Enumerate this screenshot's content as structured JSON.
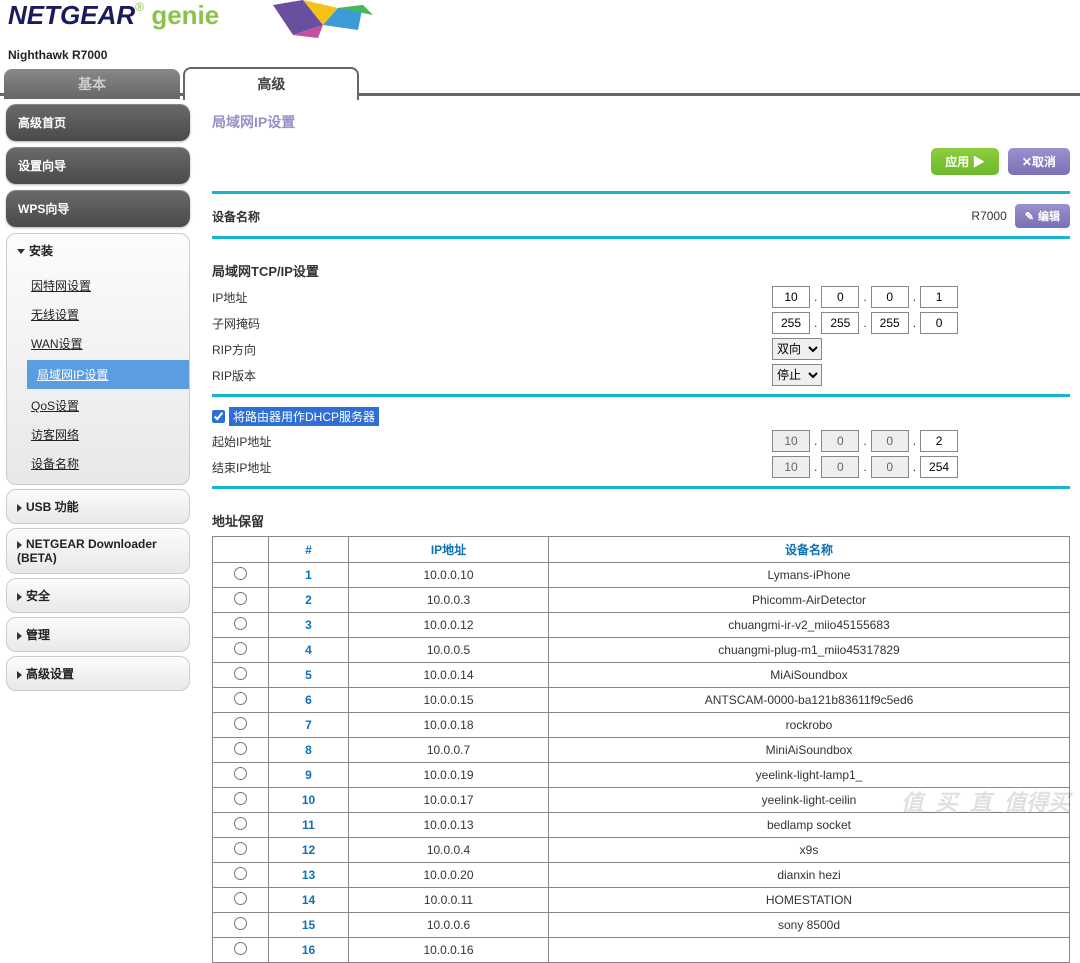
{
  "header": {
    "brand": "NETGEAR",
    "sub_brand": "genie",
    "model": "Nighthawk R7000"
  },
  "tabs": {
    "basic": "基本",
    "advanced": "高级"
  },
  "sidebar": {
    "adv_home": "高级首页",
    "setup_wizard": "设置向导",
    "wps_wizard": "WPS向导",
    "install": {
      "title": "安装",
      "items": [
        "因特网设置",
        "无线设置",
        "WAN设置",
        "局域网IP设置",
        "QoS设置",
        "访客网络",
        "设备名称"
      ]
    },
    "usb": "USB 功能",
    "downloader": "NETGEAR Downloader (BETA)",
    "security": "安全",
    "manage": "管理",
    "adv_setup": "高级设置"
  },
  "page": {
    "title": "局域网IP设置",
    "apply": "应用",
    "cancel": "取消",
    "device_name_label": "设备名称",
    "device_name": "R7000",
    "edit": "编辑",
    "tcpip_head": "局域网TCP/IP设置",
    "ip_label": "IP地址",
    "ip": [
      "10",
      "0",
      "0",
      "1"
    ],
    "mask_label": "子网掩码",
    "mask": [
      "255",
      "255",
      "255",
      "0"
    ],
    "rip_dir_label": "RIP方向",
    "rip_dir": "双向",
    "rip_ver_label": "RIP版本",
    "rip_ver": "停止",
    "dhcp_label": "将路由器用作DHCP服务器",
    "start_ip_label": "起始IP地址",
    "start_ip": [
      "10",
      "0",
      "0",
      "2"
    ],
    "end_ip_label": "结束IP地址",
    "end_ip": [
      "10",
      "0",
      "0",
      "254"
    ],
    "reserve_head": "地址保留",
    "table_headers": [
      "#",
      "IP地址",
      "设备名称"
    ],
    "rows": [
      {
        "n": "1",
        "ip": "10.0.0.10",
        "name": "Lymans-iPhone"
      },
      {
        "n": "2",
        "ip": "10.0.0.3",
        "name": "Phicomm-AirDetector"
      },
      {
        "n": "3",
        "ip": "10.0.0.12",
        "name": "chuangmi-ir-v2_miio45155683"
      },
      {
        "n": "4",
        "ip": "10.0.0.5",
        "name": "chuangmi-plug-m1_miio45317829"
      },
      {
        "n": "5",
        "ip": "10.0.0.14",
        "name": "MiAiSoundbox"
      },
      {
        "n": "6",
        "ip": "10.0.0.15",
        "name": "ANTSCAM-0000-ba121b83611f9c5ed6"
      },
      {
        "n": "7",
        "ip": "10.0.0.18",
        "name": "rockrobo"
      },
      {
        "n": "8",
        "ip": "10.0.0.7",
        "name": "MiniAiSoundbox"
      },
      {
        "n": "9",
        "ip": "10.0.0.19",
        "name": "yeelink-light-lamp1_"
      },
      {
        "n": "10",
        "ip": "10.0.0.17",
        "name": "yeelink-light-ceilin"
      },
      {
        "n": "11",
        "ip": "10.0.0.13",
        "name": "bedlamp socket"
      },
      {
        "n": "12",
        "ip": "10.0.0.4",
        "name": "x9s"
      },
      {
        "n": "13",
        "ip": "10.0.0.20",
        "name": "dianxin hezi"
      },
      {
        "n": "14",
        "ip": "10.0.0.11",
        "name": "HOMESTATION"
      },
      {
        "n": "15",
        "ip": "10.0.0.6",
        "name": "sony 8500d"
      },
      {
        "n": "16",
        "ip": "10.0.0.16",
        "name": ""
      }
    ]
  },
  "watermark": "值_买_直_值得买"
}
